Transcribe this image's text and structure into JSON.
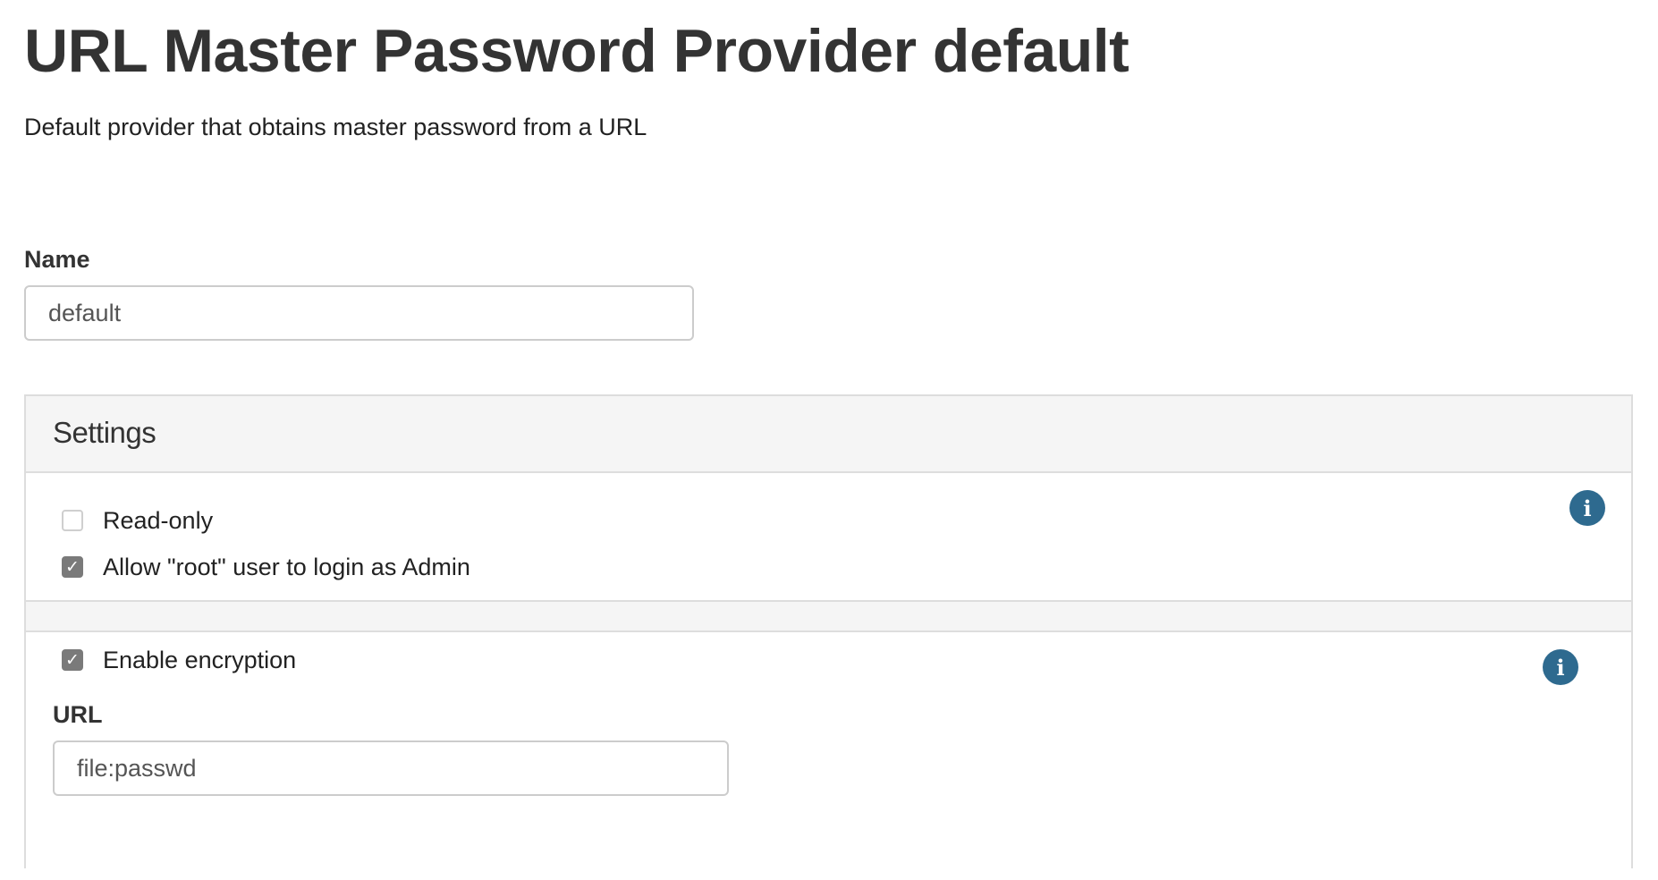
{
  "page": {
    "title": "URL Master Password Provider default",
    "description": "Default provider that obtains master password from a URL"
  },
  "name_field": {
    "label": "Name",
    "value": "default"
  },
  "settings": {
    "title": "Settings",
    "general": {
      "read_only": {
        "label": "Read-only",
        "checked": false
      },
      "allow_root": {
        "label": "Allow \"root\" user to login as Admin",
        "checked": true
      },
      "info_icon": "info-icon"
    },
    "encryption": {
      "enable_encryption": {
        "label": "Enable encryption",
        "checked": true
      },
      "info_icon": "info-icon",
      "url_field": {
        "label": "URL",
        "value": "file:passwd"
      }
    }
  },
  "colors": {
    "info_icon_bg": "#2e6a8f",
    "checkbox_checked": "#7a7a7a",
    "panel_header_bg": "#f5f5f5",
    "border": "#dddddd"
  }
}
